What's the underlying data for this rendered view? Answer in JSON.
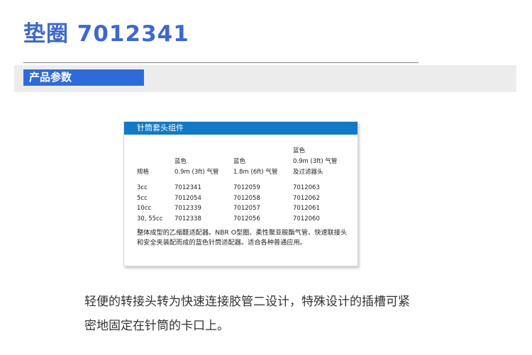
{
  "page": {
    "title": "垫圈 7012341",
    "section_label": "产品参数"
  },
  "spec_table": {
    "header": "针筒套头组件",
    "columns": {
      "spec": "规格",
      "col2_line1": "蓝色",
      "col2_line2": "0.9m (3ft) 气管",
      "col3_line1": "蓝色",
      "col3_line2": "1.8m (6ft)  气管",
      "col4_line1": "蓝色",
      "col4_line2": "0.9m (3ft) 气管",
      "col4_line3": "及过滤器头"
    },
    "rows": [
      {
        "size": "3cc",
        "a": "7012341",
        "b": "7012059",
        "c": "7012063"
      },
      {
        "size": "5cc",
        "a": "7012054",
        "b": "7012058",
        "c": "7012062"
      },
      {
        "size": "10cc",
        "a": "7012339",
        "b": "7012057",
        "c": "7012061"
      },
      {
        "size": "30, 55cc",
        "a": "7012338",
        "b": "7012056",
        "c": "7012060"
      }
    ],
    "note": "整体成型的乙缩醛适配器。NBR  O型圈、柔性聚亚胺酯气管、快速联接头和安全夹装配而成的蓝色针筒适配器。适合各种普通应用。"
  },
  "description": "轻便的转接头转为快速连接胶管二设计，特殊设计的插槽可紧密地固定在针筒的卡口上。"
}
